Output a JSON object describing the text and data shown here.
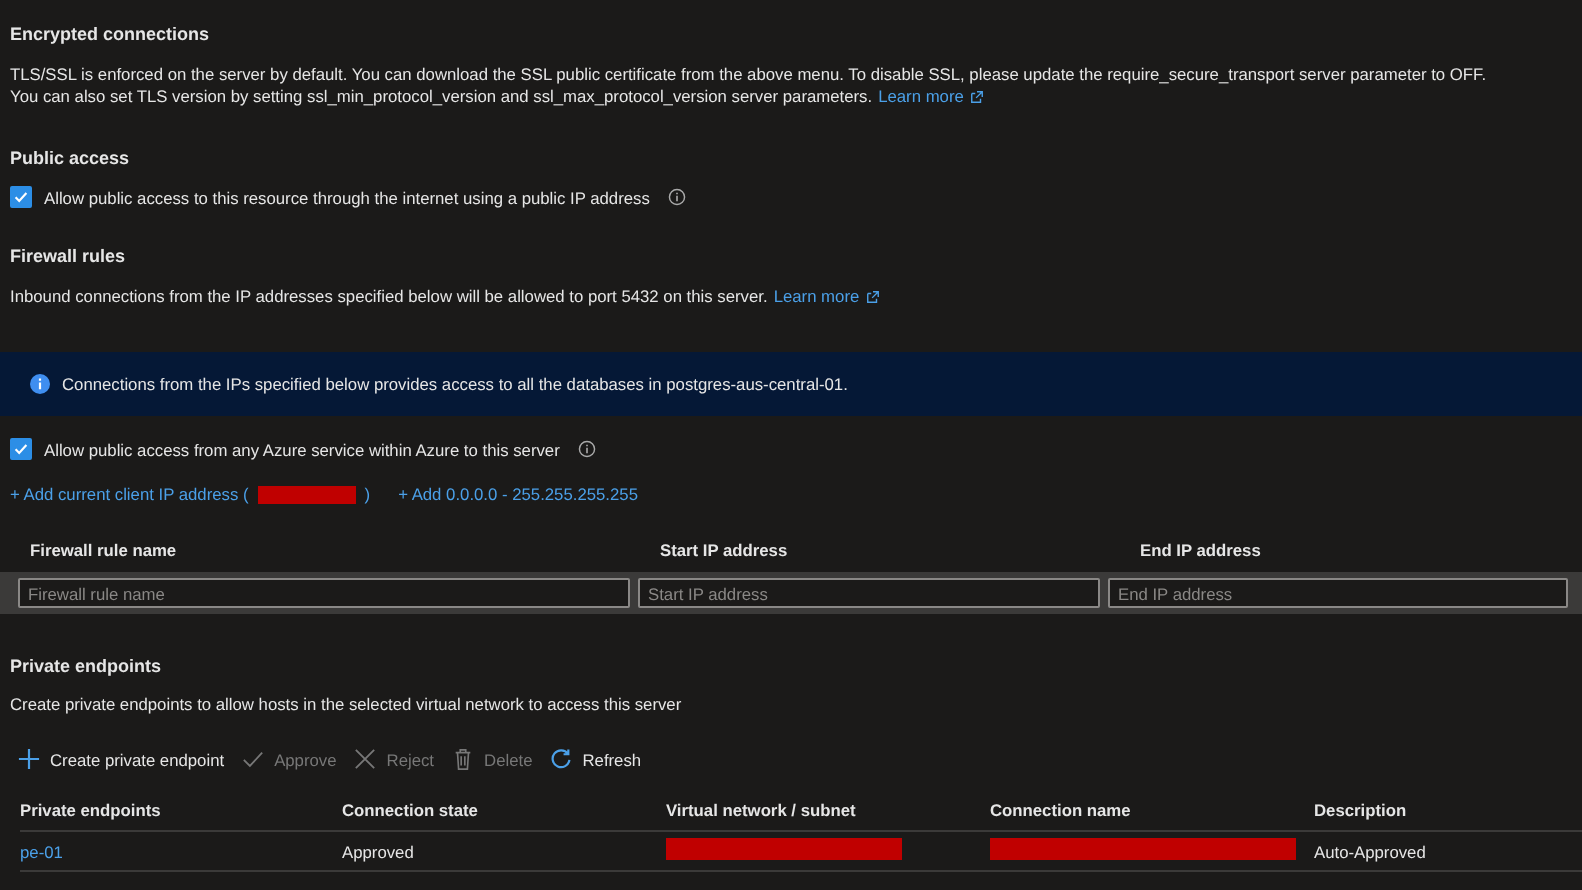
{
  "encrypted_connections": {
    "heading": "Encrypted connections",
    "lines": [
      "TLS/SSL is enforced on the server by default. You can download the SSL public certificate from the above menu. To disable SSL, please update the require_secure_transport server parameter to OFF.",
      "You can also set TLS version by setting ssl_min_protocol_version and ssl_max_protocol_version server parameters."
    ],
    "link": "Learn more"
  },
  "public_access": {
    "heading": "Public access",
    "checkbox": {
      "label": "Allow public access to this resource through the internet using a public IP address",
      "checked": true
    }
  },
  "firewall_rules": {
    "heading": "Firewall rules",
    "text": "Inbound connections from the IP addresses specified below will be allowed to port 5432 on this server.",
    "link": "Learn more",
    "info": "Connections from the IPs specified below provides access to all the databases in postgres-aus-central-01.",
    "checkbox": {
      "label": "Allow public access from any Azure service within Azure to this server",
      "checked": true
    },
    "add_client_link": {
      "before": "+ Add current client IP address (",
      "after": ")"
    },
    "add_all_link": "+ Add 0.0.0.0 - 255.255.255.255",
    "columns": [
      {
        "label": "Firewall rule name",
        "placeholder": "Firewall rule name"
      },
      {
        "label": "Start IP address",
        "placeholder": "Start IP address"
      },
      {
        "label": "End IP address",
        "placeholder": "End IP address"
      }
    ]
  },
  "private_endpoints": {
    "heading": "Private endpoints",
    "text": "Create private endpoints to allow hosts in the selected virtual network to access this server",
    "toolbar": [
      {
        "kind": "plus",
        "label": "Create private endpoint",
        "disabled": false
      },
      {
        "kind": "check",
        "label": "Approve",
        "disabled": true
      },
      {
        "kind": "x",
        "label": "Reject",
        "disabled": true
      },
      {
        "kind": "trash",
        "label": "Delete",
        "disabled": true
      },
      {
        "kind": "refresh",
        "label": "Refresh",
        "disabled": false
      }
    ],
    "columns": [
      "Private endpoints",
      "Connection state",
      "Virtual network / subnet",
      "Connection name",
      "Description"
    ],
    "rows": [
      {
        "name": "pe-01",
        "state": "Approved",
        "description": "Auto-Approved"
      }
    ]
  }
}
